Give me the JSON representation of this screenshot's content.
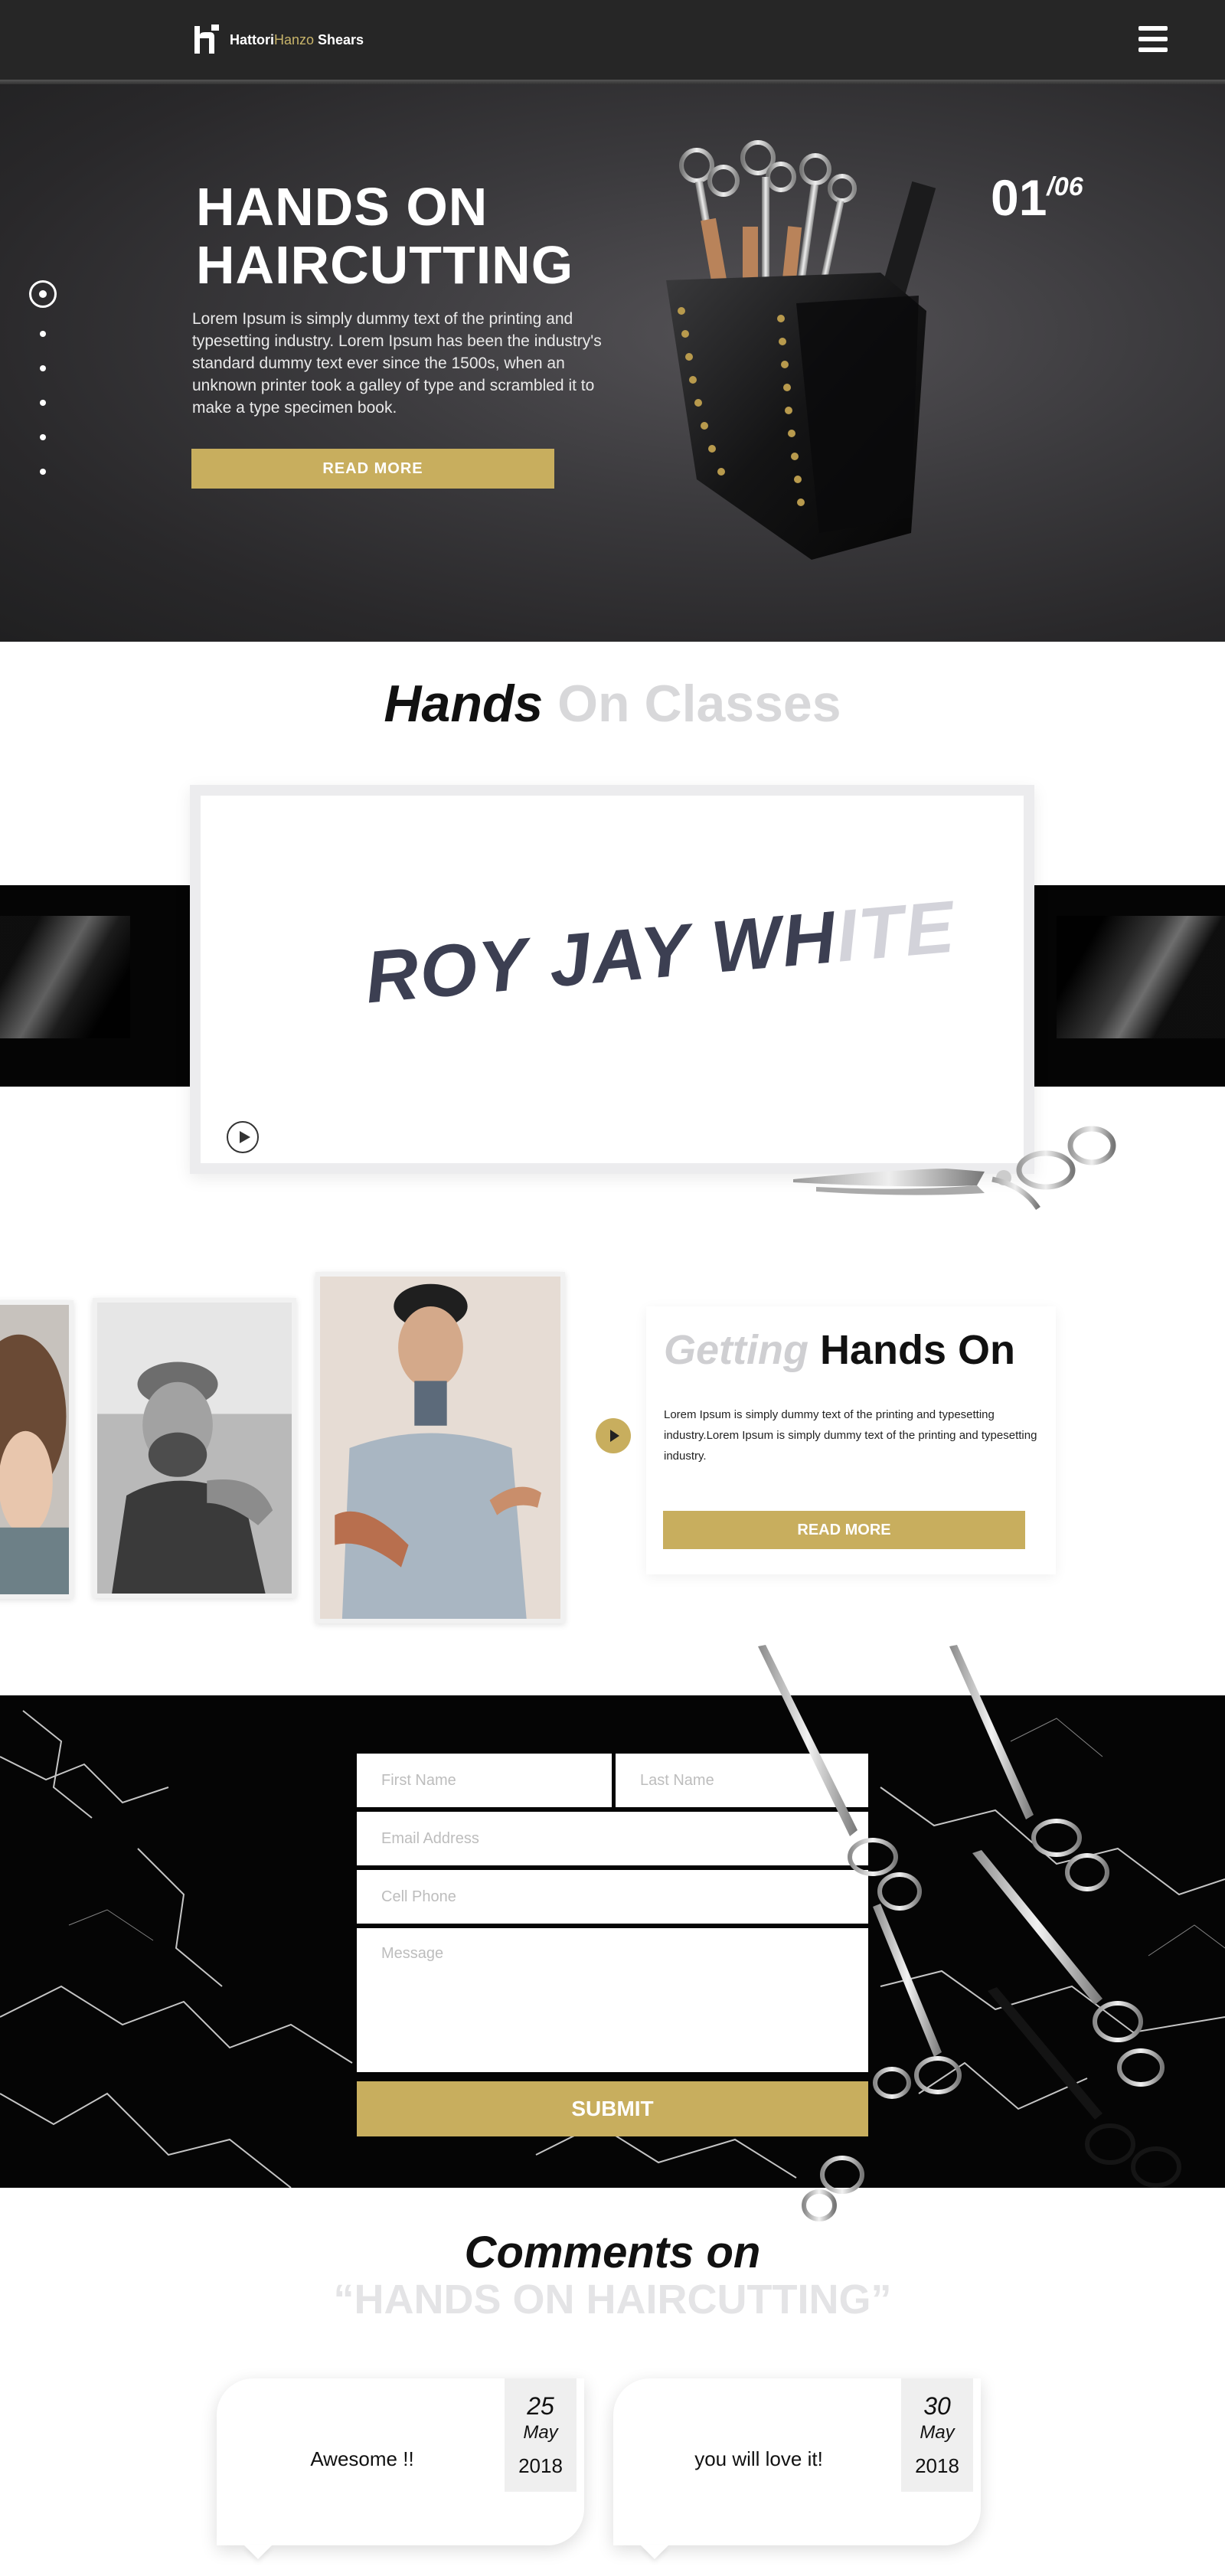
{
  "header": {
    "brand_a": "Hattori",
    "brand_b": "Hanzo",
    "brand_c": " Shears",
    "menu_icon": "hamburger-icon"
  },
  "hero": {
    "title": "HANDS ON HAIRCUTTING",
    "text": "Lorem Ipsum is simply dummy text of the printing and typesetting industry. Lorem Ipsum has been the industry's standard dummy text ever since the 1500s, when an unknown printer took a galley of type and scrambled it to make a type specimen book.",
    "button": "READ MORE",
    "counter_current": "01",
    "counter_total": "/06",
    "slide_count": 6,
    "active_slide": 1
  },
  "classes": {
    "title_dark": "Hands",
    "title_light": " On Classes",
    "video_logo_a": "ROY JAY WH",
    "video_logo_b": "ITE",
    "play_icon": "play-icon"
  },
  "getting": {
    "title_light": "Getting",
    "title_dark": " Hands On",
    "text": "Lorem Ipsum is simply dummy text of the printing and typesetting industry.Lorem Ipsum is simply dummy text of the printing and typesetting industry.",
    "button": "READ MORE",
    "next_icon": "arrow-right-icon"
  },
  "form": {
    "first_name": "First Name",
    "last_name": "Last Name",
    "email": "Email Address",
    "phone": "Cell Phone",
    "message": "Message",
    "submit": "SUBMIT"
  },
  "comments": {
    "heading": "Comments on",
    "subheading": "“HANDS ON HAIRCUTTING”",
    "items": [
      {
        "text": "Awesome !!",
        "day": "25",
        "month": "May",
        "year": "2018"
      },
      {
        "text": "you will love it!",
        "day": "30",
        "month": "May",
        "year": "2018"
      }
    ]
  },
  "colors": {
    "accent_gold": "#c8ae5e",
    "header_bg": "#262626"
  }
}
